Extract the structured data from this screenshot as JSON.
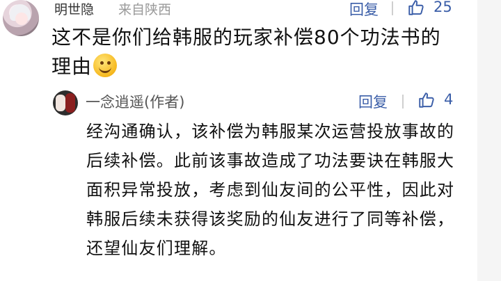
{
  "main_comment": {
    "username": "明世隐",
    "location": "来自陕西",
    "reply_label": "回复",
    "like_count": "25",
    "text": "这不是你们给韩服的玩家补偿80个功法书的理由"
  },
  "reply_comment": {
    "username": "一念逍遥(作者)",
    "reply_label": "回复",
    "like_count": "4",
    "text": "经沟通确认，该补偿为韩服某次运营投放事故的后续补偿。此前该事故造成了功法要诀在韩服大面积异常投放，考虑到仙友间的公平性，因此对韩服后续未获得该奖励的仙友进行了同等补偿，还望仙友们理解。"
  },
  "icons": {
    "like": "thumbs-up-outline-icon",
    "emoji": "smile-emoji"
  },
  "colors": {
    "link": "#3b5ea8",
    "text": "#111111",
    "muted": "#9a9a9a"
  }
}
